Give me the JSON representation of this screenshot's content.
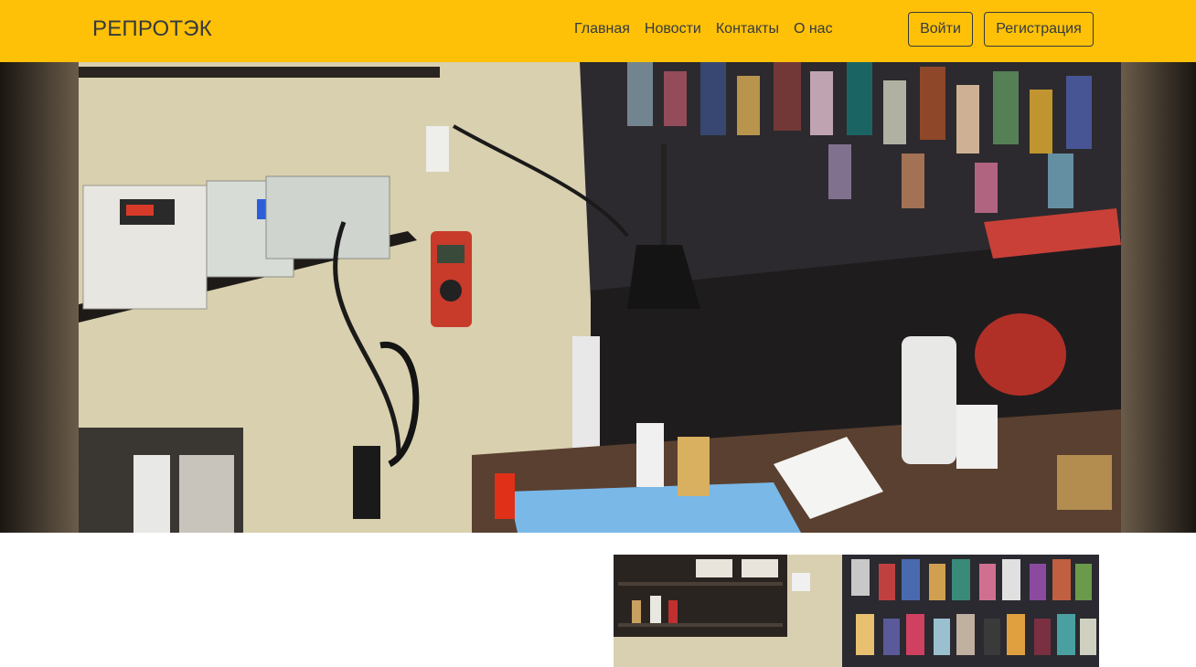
{
  "navbar": {
    "brand": "РЕПРОТЭК",
    "links": [
      {
        "label": "Главная"
      },
      {
        "label": "Новости"
      },
      {
        "label": "Контакты"
      },
      {
        "label": "О нас"
      }
    ],
    "login_label": "Войти",
    "register_label": "Регистрация"
  },
  "colors": {
    "navbar_bg": "#ffc107",
    "navbar_text": "#343a40",
    "page_bg": "#ffffff"
  },
  "hero": {
    "image_subject": "electronics repair workbench with soldering stations, multimeter, microscope and phone cases on wall"
  },
  "thumbnail": {
    "image_subject": "repair shop shelves and phone case display wall"
  }
}
